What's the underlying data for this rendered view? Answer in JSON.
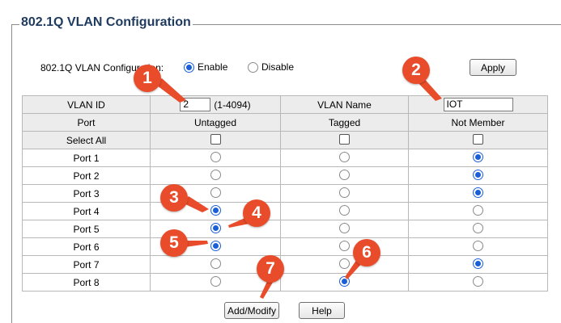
{
  "legend": "802.1Q VLAN Configuration",
  "config": {
    "label": "802.1Q VLAN Configuration:",
    "enable_label": "Enable",
    "disable_label": "Disable",
    "enabled": true
  },
  "buttons": {
    "apply": "Apply",
    "add_modify": "Add/Modify",
    "help": "Help"
  },
  "vlan": {
    "id_label": "VLAN ID",
    "id_value": "2",
    "id_range": "(1-4094)",
    "name_label": "VLAN Name",
    "name_value": "IOT"
  },
  "columns": [
    "Port",
    "Untagged",
    "Tagged",
    "Not Member"
  ],
  "select_all_label": "Select All",
  "ports": [
    {
      "name": "Port 1",
      "mode": "not_member"
    },
    {
      "name": "Port 2",
      "mode": "not_member"
    },
    {
      "name": "Port 3",
      "mode": "not_member"
    },
    {
      "name": "Port 4",
      "mode": "untagged"
    },
    {
      "name": "Port 5",
      "mode": "untagged"
    },
    {
      "name": "Port 6",
      "mode": "untagged"
    },
    {
      "name": "Port 7",
      "mode": "not_member"
    },
    {
      "name": "Port 8",
      "mode": "tagged"
    }
  ],
  "annotations": [
    "1",
    "2",
    "3",
    "4",
    "5",
    "6",
    "7"
  ],
  "colors": {
    "badge": "#e84c2b",
    "radio_selected": "#1a5fd8",
    "legend_text": "#1f3a5f"
  }
}
